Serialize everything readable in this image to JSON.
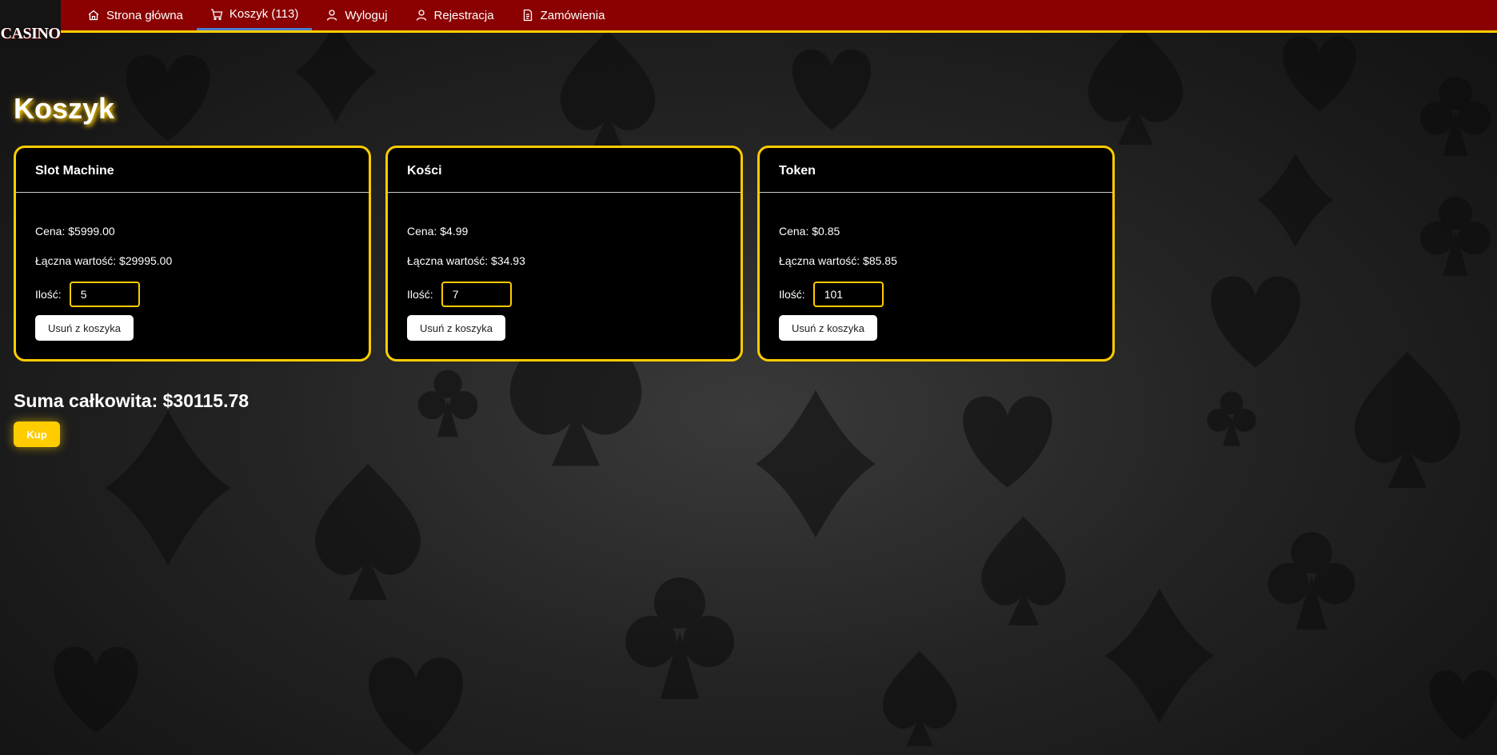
{
  "brand": {
    "logo_text": "CASINO"
  },
  "nav": {
    "items": [
      {
        "label": "Strona główna",
        "icon": "home-icon"
      },
      {
        "label": "Koszyk (113)",
        "icon": "cart-icon",
        "active": true
      },
      {
        "label": "Wyloguj",
        "icon": "user-icon"
      },
      {
        "label": "Rejestracja",
        "icon": "user-icon"
      },
      {
        "label": "Zamówienia",
        "icon": "document-icon"
      }
    ]
  },
  "page": {
    "title": "Koszyk"
  },
  "cart": {
    "items": [
      {
        "name": "Slot Machine",
        "price": "Cena: $5999.00",
        "total": "Łączna wartość: $29995.00",
        "qty_label": "Ilość:",
        "qty": "5",
        "remove_label": "Usuń z koszyka"
      },
      {
        "name": "Kości",
        "price": "Cena: $4.99",
        "total": "Łączna wartość: $34.93",
        "qty_label": "Ilość:",
        "qty": "7",
        "remove_label": "Usuń z koszyka"
      },
      {
        "name": "Token",
        "price": "Cena: $0.85",
        "total": "Łączna wartość: $85.85",
        "qty_label": "Ilość:",
        "qty": "101",
        "remove_label": "Usuń z koszyka"
      }
    ],
    "sum_text": "Suma całkowita: $30115.78",
    "buy_label": "Kup"
  },
  "colors": {
    "navbar": "#8b0000",
    "accent": "#ffcc00",
    "card_bg": "#000000",
    "active_underline": "#4a7fd1"
  }
}
